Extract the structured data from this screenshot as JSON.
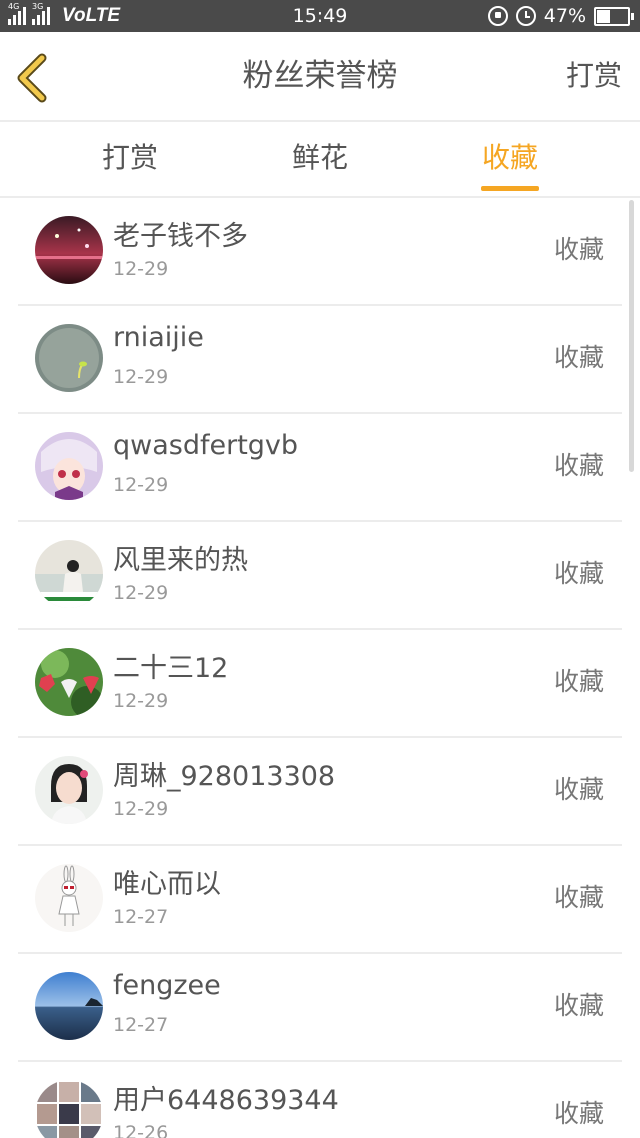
{
  "status_bar": {
    "network_1": "4G",
    "network_2": "3G",
    "volte": "VoLTE",
    "time": "15:49",
    "battery_percent": "47%",
    "battery_level": 0.47
  },
  "header": {
    "title": "粉丝荣誉榜",
    "action": "打赏"
  },
  "tabs": [
    {
      "label": "打赏",
      "active": false
    },
    {
      "label": "鲜花",
      "active": false
    },
    {
      "label": "收藏",
      "active": true
    }
  ],
  "accent_color": "#f5a623",
  "list": [
    {
      "name": "老子钱不多",
      "date": "12-29",
      "action": "收藏"
    },
    {
      "name": "rniaijie",
      "date": "12-29",
      "action": "收藏"
    },
    {
      "name": "qwasdfertgvb",
      "date": "12-29",
      "action": "收藏"
    },
    {
      "name": "风里来的热",
      "date": "12-29",
      "action": "收藏"
    },
    {
      "name": "二十三12",
      "date": "12-29",
      "action": "收藏"
    },
    {
      "name": "周琳_928013308",
      "date": "12-29",
      "action": "收藏"
    },
    {
      "name": "唯心而以",
      "date": "12-27",
      "action": "收藏"
    },
    {
      "name": "fengzee",
      "date": "12-27",
      "action": "收藏"
    },
    {
      "name": "用户6448639344",
      "date": "12-26",
      "action": "收藏"
    }
  ]
}
